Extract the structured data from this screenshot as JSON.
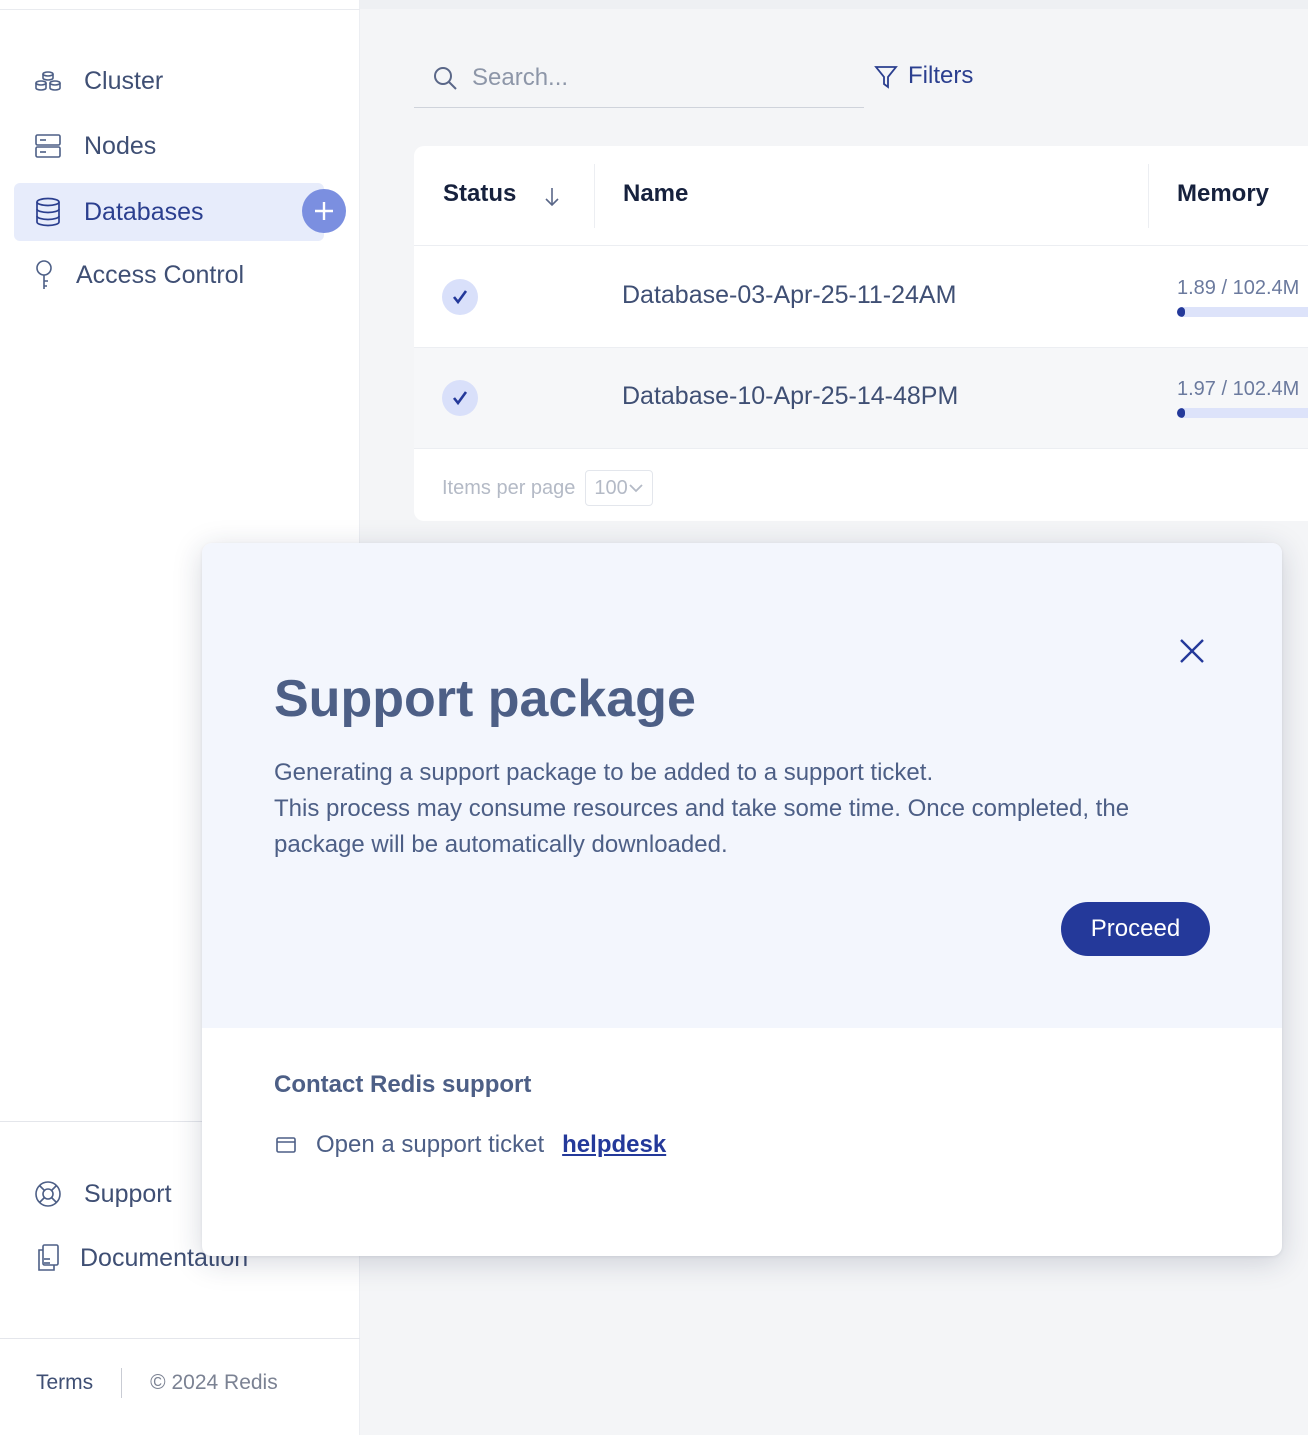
{
  "sidebar": {
    "items": [
      {
        "label": "Cluster",
        "icon": "cluster-icon",
        "active": false
      },
      {
        "label": "Nodes",
        "icon": "nodes-icon",
        "active": false
      },
      {
        "label": "Databases",
        "icon": "database-icon",
        "active": true
      },
      {
        "label": "Access Control",
        "icon": "key-icon",
        "active": false
      }
    ],
    "bottom_items": [
      {
        "label": "Support",
        "icon": "lifebuoy-icon"
      },
      {
        "label": "Documentation",
        "icon": "documentation-icon"
      }
    ],
    "footer": {
      "terms": "Terms",
      "copyright": "© 2024 Redis"
    }
  },
  "search": {
    "placeholder": "Search..."
  },
  "filters": {
    "label": "Filters"
  },
  "table": {
    "columns": [
      "Status",
      "Name",
      "Memory"
    ],
    "rows": [
      {
        "name": "Database-03-Apr-25-11-24AM",
        "memory": "1.89 / 102.4M",
        "memory_fraction": 0.018
      },
      {
        "name": "Database-10-Apr-25-14-48PM",
        "memory": "1.97 / 102.4M",
        "memory_fraction": 0.019
      }
    ],
    "pager": {
      "label": "Items per page",
      "value": "100"
    }
  },
  "modal": {
    "title": "Support package",
    "body_line1": "Generating a support package to be added to a support ticket.",
    "body_line2": "This process may consume resources and take some time. Once completed, the package will be automatically downloaded.",
    "proceed_label": "Proceed",
    "contact_title": "Contact Redis support",
    "ticket_text": "Open a support ticket",
    "ticket_link": "helpdesk"
  },
  "colors": {
    "accent": "#24399a",
    "active_bg": "#e7ecfb",
    "modal_top_bg": "#f3f6fd",
    "status_dot_bg": "#d9e0fa"
  }
}
